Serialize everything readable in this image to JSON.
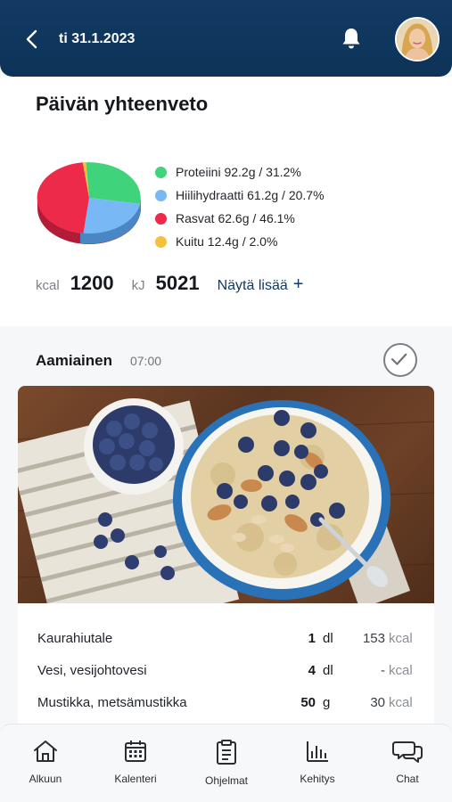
{
  "header": {
    "date": "ti 31.1.2023"
  },
  "summary": {
    "title": "Päivän yhteenveto",
    "legend": [
      {
        "label": "Proteiini 92.2g / 31.2%",
        "color": "#3fd47c"
      },
      {
        "label": "Hiilihydraatti 61.2g / 20.7%",
        "color": "#78b9f5"
      },
      {
        "label": "Rasvat 62.6g / 46.1%",
        "color": "#ee2a4a"
      },
      {
        "label": "Kuitu 12.4g / 2.0%",
        "color": "#f6bf3c"
      }
    ],
    "kcal_label": "kcal",
    "kcal_value": "1200",
    "kj_label": "kJ",
    "kj_value": "5021",
    "more_label": "Näytä lisää",
    "more_icon": "+"
  },
  "meal": {
    "name": "Aamiainen",
    "time": "07:00",
    "items": [
      {
        "name": "Kaurahiutale",
        "amount": "1",
        "unit": "dl",
        "kcal": "153",
        "kcal_unit": "kcal"
      },
      {
        "name": "Vesi, vesijohtovesi",
        "amount": "4",
        "unit": "dl",
        "kcal": "-",
        "kcal_unit": "kcal"
      },
      {
        "name": "Mustikka, metsämustikka",
        "amount": "50",
        "unit": "g",
        "kcal": "30",
        "kcal_unit": "kcal"
      }
    ]
  },
  "tabs": [
    {
      "label": "Alkuun",
      "icon": "home-icon"
    },
    {
      "label": "Kalenteri",
      "icon": "calendar-icon"
    },
    {
      "label": "Ohjelmat",
      "icon": "clipboard-icon"
    },
    {
      "label": "Kehitys",
      "icon": "bar-chart-icon"
    },
    {
      "label": "Chat",
      "icon": "chat-icon"
    }
  ]
}
